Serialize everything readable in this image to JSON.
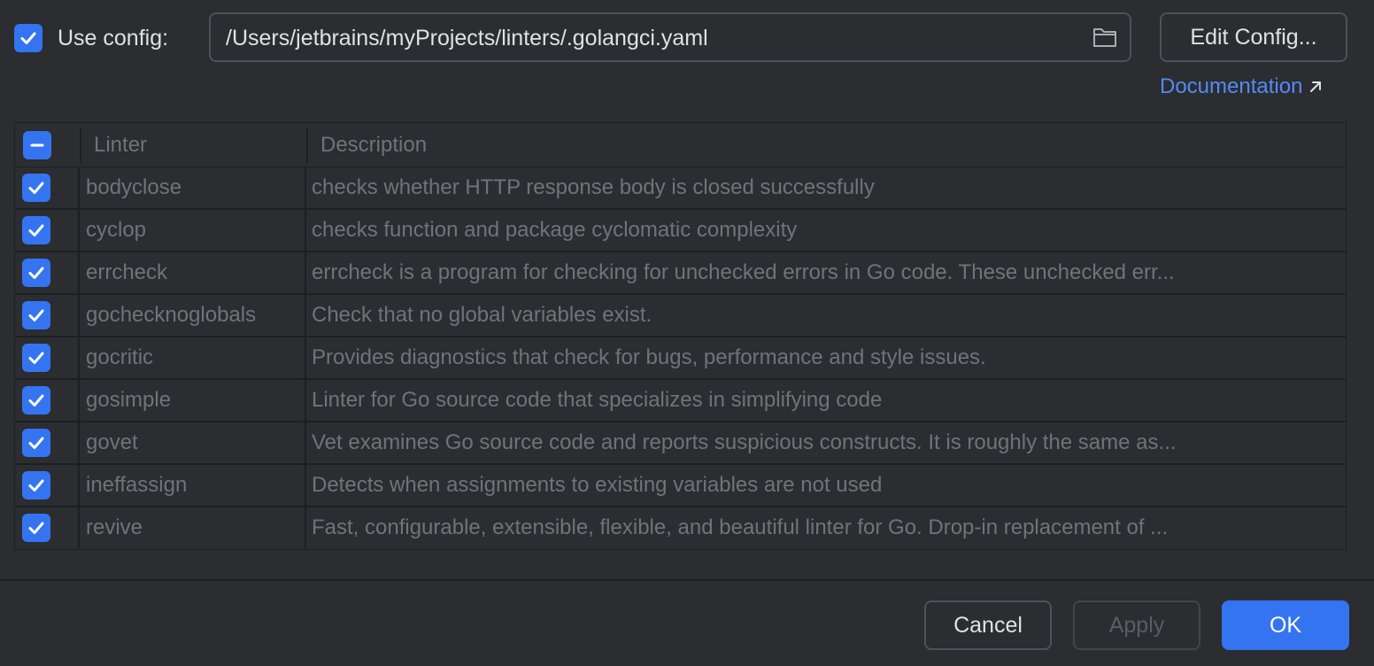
{
  "config": {
    "use_config_label": "Use config:",
    "use_config_checked": true,
    "path_value": "/Users/jetbrains/myProjects/linters/.golangci.yaml",
    "edit_config_label": "Edit Config...",
    "documentation_label": "Documentation"
  },
  "table": {
    "columns": [
      "Linter",
      "Description"
    ],
    "header_checkbox_state": "indeterminate",
    "rows": [
      {
        "linter": "bodyclose",
        "description": "checks whether HTTP response body is closed successfully",
        "checked": true
      },
      {
        "linter": "cyclop",
        "description": "checks function and package cyclomatic complexity",
        "checked": true
      },
      {
        "linter": "errcheck",
        "description": "errcheck is a program for checking for unchecked errors in Go code. These unchecked err...",
        "checked": true
      },
      {
        "linter": "gochecknoglobals",
        "description": "Check that no global variables exist.",
        "checked": true
      },
      {
        "linter": "gocritic",
        "description": "Provides diagnostics that check for bugs, performance and style issues.",
        "checked": true
      },
      {
        "linter": "gosimple",
        "description": "Linter for Go source code that specializes in simplifying code",
        "checked": true
      },
      {
        "linter": "govet",
        "description": "Vet examines Go source code and reports suspicious constructs. It is roughly the same as...",
        "checked": true
      },
      {
        "linter": "ineffassign",
        "description": "Detects when assignments to existing variables are not used",
        "checked": true
      },
      {
        "linter": "revive",
        "description": "Fast, configurable, extensible, flexible, and beautiful linter for Go. Drop-in replacement of ...",
        "checked": true
      }
    ]
  },
  "buttons": {
    "cancel": "Cancel",
    "apply": "Apply",
    "ok": "OK"
  },
  "colors": {
    "background": "#2b2d30",
    "accent": "#3574f0",
    "link": "#548af7",
    "muted_text": "#6f737a"
  },
  "icons": {
    "use_config_checkbox": "checkmark-icon",
    "folder": "folder-icon",
    "external_link": "arrow-up-right-icon",
    "header_checkbox": "minus-icon",
    "row_checkbox": "checkmark-icon"
  }
}
